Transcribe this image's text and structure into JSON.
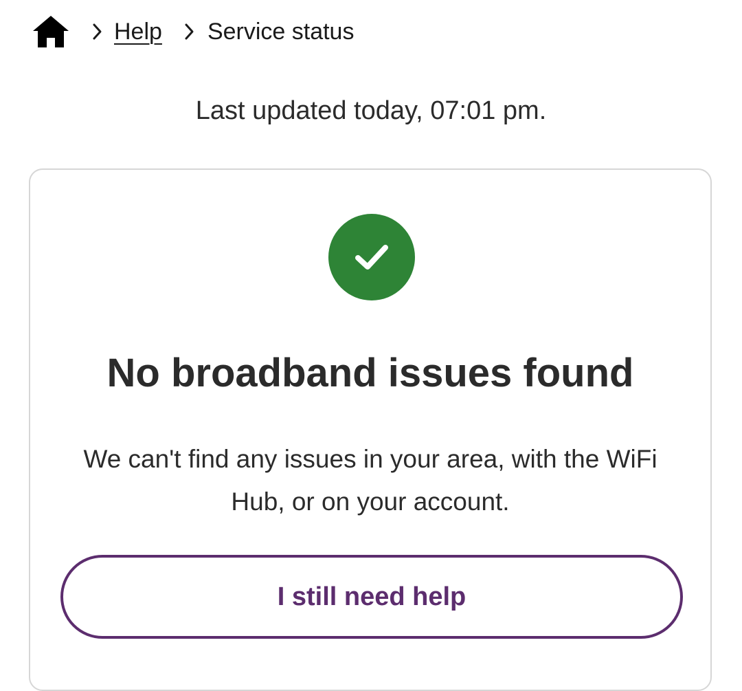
{
  "breadcrumb": {
    "home_icon": "home-icon",
    "separator_icon": "chevron-right-icon",
    "help_label": "Help",
    "current_label": "Service status"
  },
  "last_updated": "Last updated today, 07:01 pm.",
  "status_card": {
    "icon": "check-circle-icon",
    "icon_color": "#2e8436",
    "title": "No broadband issues found",
    "description": "We can't find any issues in your area, with the WiFi Hub, or on your account.",
    "button_label": "I still need help",
    "button_color": "#5c2d6e"
  }
}
